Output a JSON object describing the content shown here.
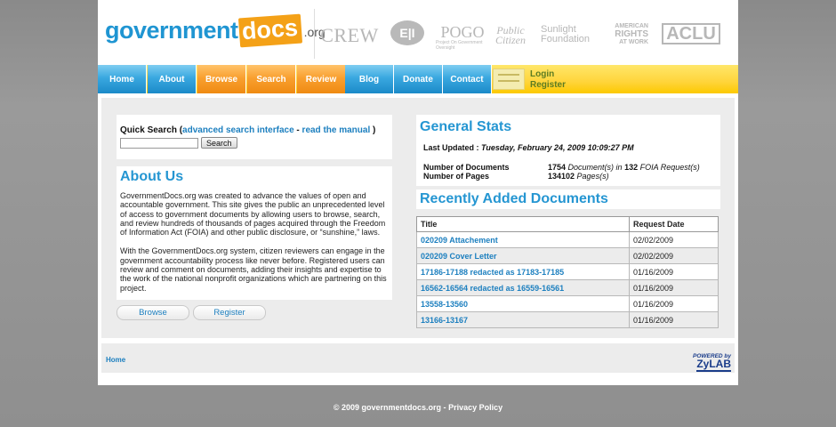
{
  "header": {
    "logo_main": "government",
    "logo_docs": "docs",
    "logo_tld": ".org",
    "partners": {
      "crew": "CREW",
      "ei": "E|I",
      "pogo": "POGO",
      "pogo_sub": "Project On Government Oversight",
      "citizen_1": "Public",
      "citizen_2": "Citizen",
      "sunlight_1": "Sunlight",
      "sunlight_2": "Foundation",
      "arw_1": "AMERICAN",
      "arw_2": "RIGHTS",
      "arw_3": "AT WORK",
      "aclu": "ACLU"
    }
  },
  "nav": {
    "tabs": [
      {
        "label": "Home",
        "color": "blue"
      },
      {
        "label": "About",
        "color": "blue"
      },
      {
        "label": "Browse",
        "color": "orange"
      },
      {
        "label": "Search",
        "color": "orange"
      },
      {
        "label": "Review",
        "color": "orange"
      },
      {
        "label": "Blog",
        "color": "blue"
      },
      {
        "label": "Donate",
        "color": "blue"
      },
      {
        "label": "Contact",
        "color": "blue"
      }
    ],
    "login": "Login",
    "register": "Register"
  },
  "quick_search": {
    "label": "Quick Search",
    "paren_open": " (",
    "advanced_link": "advanced search interface",
    "separator": " - ",
    "manual_link": "read the manual",
    "paren_close": " )",
    "input_value": "",
    "button": "Search"
  },
  "about": {
    "title": "About Us",
    "para1": "GovernmentDocs.org was created to advance the values of open and accountable government. This site gives the public an unprecedented level of access to government documents by allowing users to browse, search, and review hundreds of thousands of pages acquired through the Freedom of Information Act (FOIA) and other public disclosure, or “sunshine,” laws.",
    "para2": "With the GovernmentDocs.org system, citizen reviewers can engage in the government accountability process like never before. Registered users can review and comment on documents, adding their insights and expertise to the work of the national nonprofit organizations which are partnering on this project.",
    "browse_button": "Browse",
    "register_button": "Register"
  },
  "stats": {
    "title": "General Stats",
    "updated_label": "Last Updated : ",
    "updated_value": "Tuesday, February 24, 2009 10:09:27 PM",
    "docs_label": "Number of Documents",
    "docs_count": "1754",
    "docs_mid": " Document(s) in ",
    "foia_count": "132",
    "docs_tail": " FOIA Request(s)",
    "pages_label": "Number of Pages",
    "pages_count": "134102",
    "pages_tail": " Pages(s)"
  },
  "recent": {
    "title": "Recently Added Documents",
    "columns": [
      "Title",
      "Request Date"
    ],
    "rows": [
      {
        "title": "020209 Attachement",
        "date": "02/02/2009"
      },
      {
        "title": "020209 Cover Letter",
        "date": "02/02/2009"
      },
      {
        "title": "17186-17188 redacted as 17183-17185",
        "date": "01/16/2009"
      },
      {
        "title": "16562-16564 redacted as 16559-16561",
        "date": "01/16/2009"
      },
      {
        "title": "13558-13560",
        "date": "01/16/2009"
      },
      {
        "title": "13166-13167",
        "date": "01/16/2009"
      }
    ]
  },
  "footer": {
    "home_link": "Home",
    "powered_by": "POWERED by",
    "powered_brand": "ZyLAB",
    "copyright_prefix": "© 2009 governmentdocs.org - ",
    "privacy_link": "Privacy Policy"
  },
  "colors": {
    "accent_blue": "#2596d2",
    "link_blue": "#1c7fbf",
    "nav_orange": "#f9a030",
    "nav_yellow": "#ffd43a"
  }
}
